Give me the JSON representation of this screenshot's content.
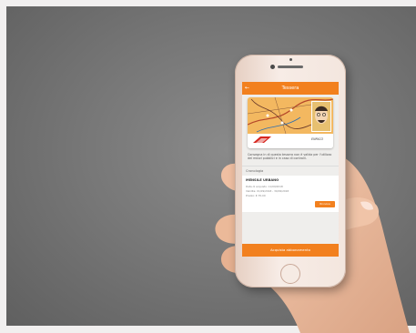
{
  "app": {
    "title": "Tessera",
    "back_glyph": "←"
  },
  "card": {
    "holder_name": "ENRICO"
  },
  "info_text": "Consegna in di questa tessera non è valida per l'utilizzo dei mezzi pubblici e in caso di controlli.",
  "section_label": "Cronologia",
  "pass": {
    "title": "MENSILE URBANO",
    "lines": [
      "Data di acquisto: 11/09/2018",
      "Validita: 01/09/2018 - 30/09/2018",
      "Prezzo: € 35,00"
    ],
    "renew_label": "Rinnova"
  },
  "cta_label": "Acquista abbonamento",
  "colors": {
    "accent": "#f2801e",
    "background": "#777777"
  }
}
